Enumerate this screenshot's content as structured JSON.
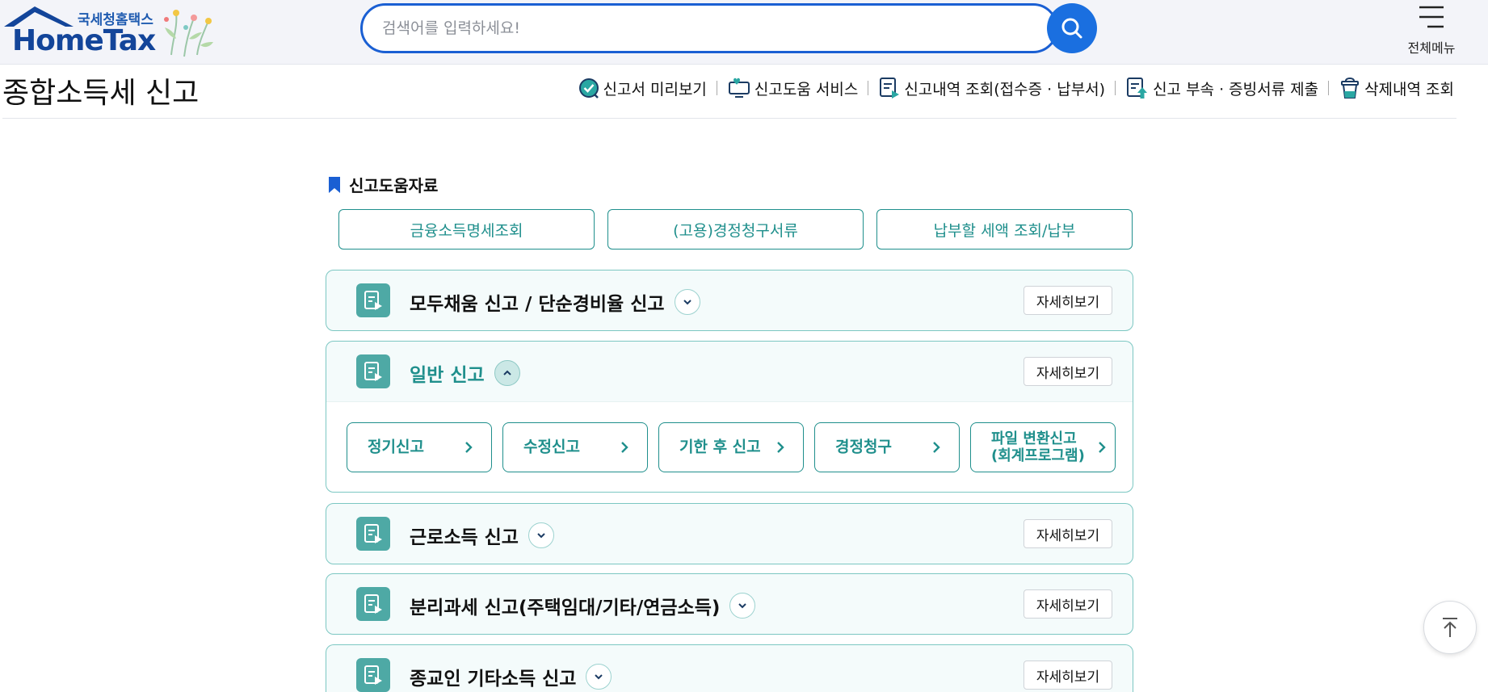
{
  "header": {
    "logo_sub": "국세청홈택스",
    "logo_main": "HomeTax",
    "search_placeholder": "검색어를 입력하세요!",
    "search_icon": "search-icon",
    "menu_label": "전체메뉴",
    "menu_icon": "hamburger-icon"
  },
  "page": {
    "title": "종합소득세 신고",
    "quick_links": [
      {
        "label": "신고서 미리보기",
        "icon": "check-circle-icon"
      },
      {
        "label": "신고도움 서비스",
        "icon": "monitor-heart-icon"
      },
      {
        "label": "신고내역 조회(접수증 · 납부서)",
        "icon": "document-play-icon"
      },
      {
        "label": "신고 부속 · 증빙서류 제출",
        "icon": "document-upload-icon"
      },
      {
        "label": "삭제내역 조회",
        "icon": "trash-icon"
      }
    ]
  },
  "help": {
    "heading": "신고도움자료",
    "heading_icon": "bookmark-icon",
    "buttons": [
      "금융소득명세조회",
      "(고용)경정청구서류",
      "납부할 세액 조회/납부"
    ]
  },
  "accordions": [
    {
      "title": "모두채움 신고 / 단순경비율 신고",
      "expanded": false,
      "detail_label": "자세히보기"
    },
    {
      "title": "일반 신고",
      "expanded": true,
      "detail_label": "자세히보기",
      "sub_buttons": [
        "정기신고",
        "수정신고",
        "기한 후 신고",
        "경정청구",
        "파일 변환신고\n(회계프로그램)"
      ]
    },
    {
      "title": "근로소득 신고",
      "expanded": false,
      "detail_label": "자세히보기"
    },
    {
      "title": "분리과세 신고(주택임대/기타/연금소득)",
      "expanded": false,
      "detail_label": "자세히보기"
    },
    {
      "title": "종교인 기타소득 신고",
      "expanded": false,
      "detail_label": "자세히보기"
    }
  ],
  "colors": {
    "brand_blue": "#1a6fe0",
    "teal": "#1f8f8c",
    "teal_light_bg": "#f4fbfb",
    "teal_border": "#7cc7c2"
  },
  "scroll_top_icon": "arrow-up-to-top-icon"
}
